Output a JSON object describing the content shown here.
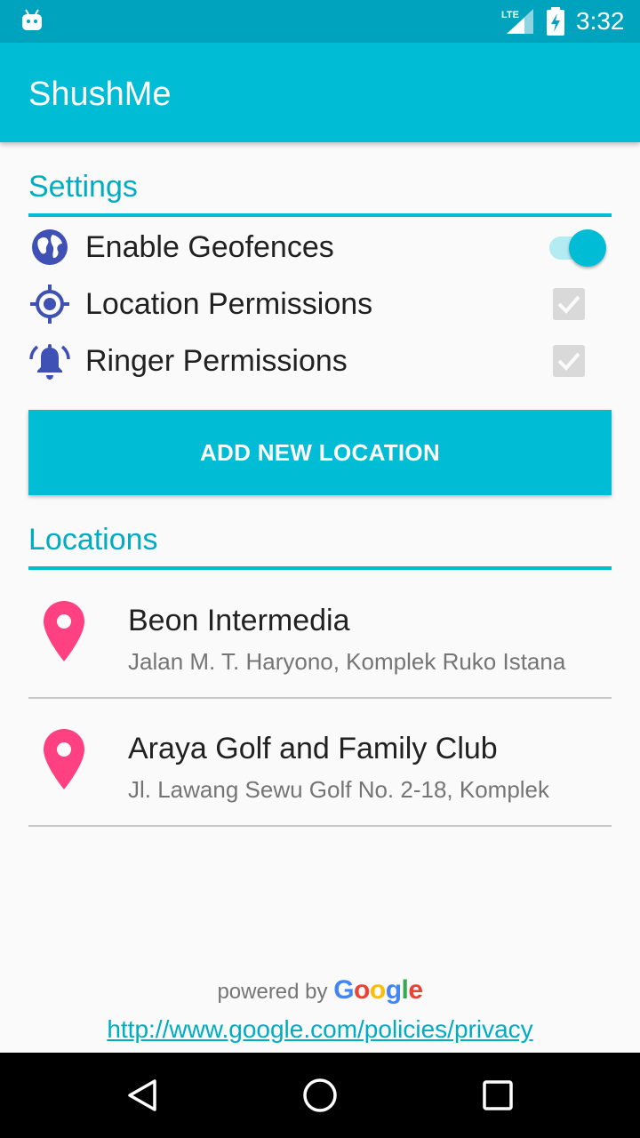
{
  "status_bar": {
    "network_label": "LTE",
    "time": "3:32"
  },
  "app_bar": {
    "title": "ShushMe"
  },
  "settings": {
    "section_title": "Settings",
    "items": [
      {
        "label": "Enable Geofences",
        "icon": "globe-icon",
        "control": "switch",
        "checked": true
      },
      {
        "label": "Location Permissions",
        "icon": "gps-fixed-icon",
        "control": "checkbox",
        "checked": true,
        "enabled": false
      },
      {
        "label": "Ringer Permissions",
        "icon": "ringing-bell-icon",
        "control": "checkbox",
        "checked": true,
        "enabled": false
      }
    ]
  },
  "add_location_label": "ADD NEW LOCATION",
  "locations": {
    "section_title": "Locations",
    "items": [
      {
        "name": "Beon Intermedia",
        "address": "Jalan M. T. Haryono, Komplek Ruko Istana",
        "icon": "place-pin-icon"
      },
      {
        "name": "Araya Golf and Family Club",
        "address": "Jl. Lawang Sewu Golf No. 2-18, Komplek",
        "icon": "place-pin-icon"
      }
    ]
  },
  "attribution": {
    "prefix": "powered by",
    "logo_letters": [
      "G",
      "o",
      "o",
      "g",
      "l",
      "e"
    ]
  },
  "privacy_link": "http://www.google.com/policies/privacy",
  "colors": {
    "primary": "#00bcd4",
    "primary_dark": "#00a3bd",
    "accent": "#00acc1",
    "icon_indigo": "#3f51b5",
    "pin_pink": "#ff4081"
  },
  "nav_bar": [
    "back-icon",
    "home-icon",
    "recents-icon"
  ]
}
